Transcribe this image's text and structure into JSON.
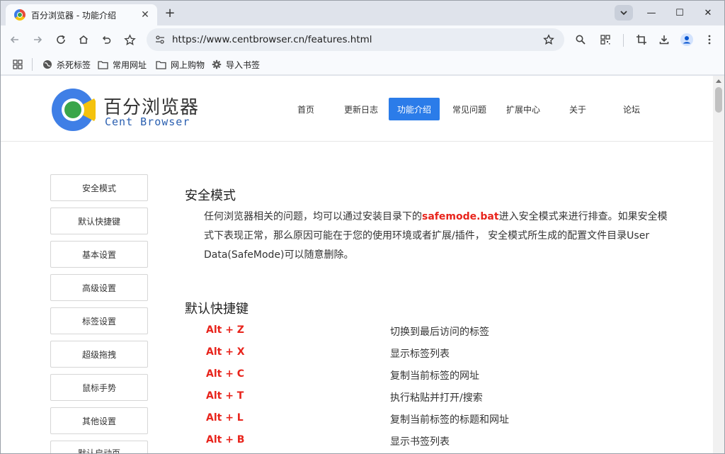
{
  "browser": {
    "tab_title": "百分浏览器 - 功能介绍",
    "tab_close": "✕",
    "new_tab": "+",
    "url": "https://www.centbrowser.cn/features.html",
    "window_controls": {
      "minimize": "—",
      "maximize": "☐",
      "close": "✕"
    },
    "bookmarks": [
      {
        "label": "杀死标签",
        "icon": "globe-icon"
      },
      {
        "label": "常用网址",
        "icon": "folder-icon"
      },
      {
        "label": "网上购物",
        "icon": "folder-icon"
      },
      {
        "label": "导入书签",
        "icon": "gear-icon"
      }
    ]
  },
  "site": {
    "logo_cn": "百分浏览器",
    "logo_en": "Cent Browser",
    "nav": [
      "首页",
      "更新日志",
      "功能介绍",
      "常见问题",
      "扩展中心",
      "关于",
      "论坛"
    ],
    "nav_active": "功能介绍",
    "sidebar": [
      "安全模式",
      "默认快捷键",
      "基本设置",
      "高级设置",
      "标签设置",
      "超级拖拽",
      "鼠标手势",
      "其他设置",
      "默认启动页"
    ]
  },
  "sections": {
    "safe_mode": {
      "title": "安全模式",
      "text_1": "任何浏览器相关的问题，均可以通过安装目录下的",
      "highlight": "safemode.bat",
      "text_2": "进入安全模式来进行排查。如果安全模式下表现正常，那么原因可能在于您的使用环境或者扩展/插件， 安全模式所生成的配置文件目录User Data(SafeMode)可以随意删除。"
    },
    "shortcuts": {
      "title": "默认快捷键",
      "rows": [
        {
          "key": "Alt + Z",
          "desc": "切换到最后访问的标签"
        },
        {
          "key": "Alt + X",
          "desc": "显示标签列表"
        },
        {
          "key": "Alt + C",
          "desc": "复制当前标签的网址"
        },
        {
          "key": "Alt + T",
          "desc": "执行粘贴并打开/搜索"
        },
        {
          "key": "Alt + L",
          "desc": "复制当前标签的标题和网址"
        },
        {
          "key": "Alt + B",
          "desc": "显示书签列表"
        }
      ]
    }
  },
  "colors": {
    "accent": "#2b7ce9",
    "highlight": "#e8241c"
  }
}
